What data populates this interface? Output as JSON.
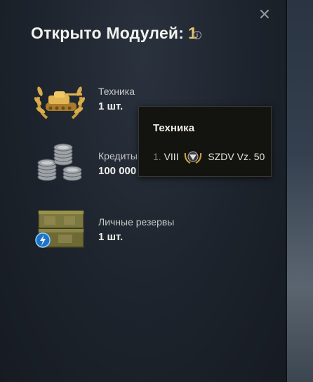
{
  "header": {
    "title": "Открыто Модулей:",
    "count": "1",
    "close_icon": "close-icon",
    "info_icon": "info-icon"
  },
  "items": [
    {
      "name": "Техника",
      "value": "1 шт.",
      "icon": "tank-laurel-icon"
    },
    {
      "name": "Кредиты",
      "value": "100 000",
      "icon": "credits-coins-icon"
    },
    {
      "name": "Личные резервы",
      "value": "1 шт.",
      "icon": "reserves-boxes-icon"
    }
  ],
  "tooltip": {
    "title": "Техника",
    "rows": [
      {
        "index": "1.",
        "tier": "VIII",
        "vehicle": "SZDV Vz. 50",
        "icon": "tier-emblem-icon"
      }
    ]
  },
  "colors": {
    "accent": "#e8c66b",
    "panel_bg": "#1d232c",
    "tooltip_bg": "#13130f"
  }
}
